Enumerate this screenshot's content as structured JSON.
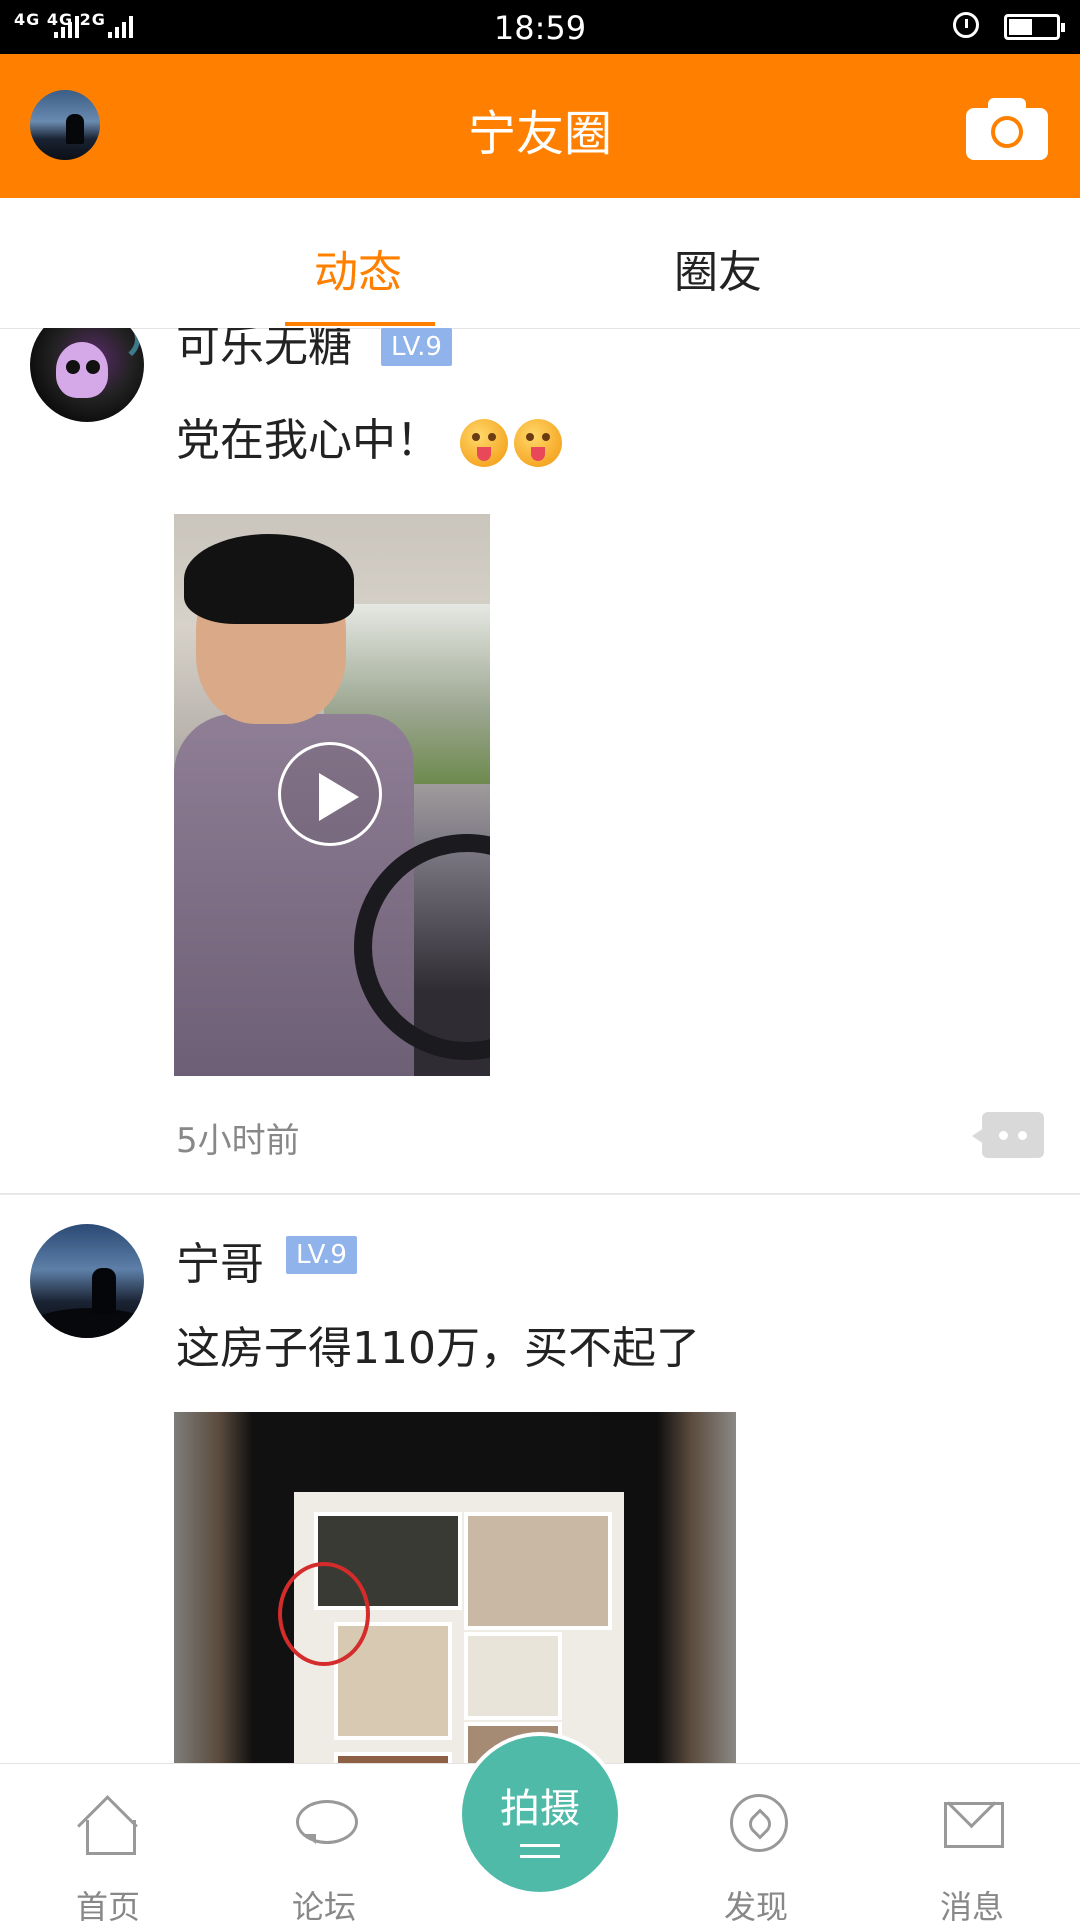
{
  "status_bar": {
    "network": "4G 4G 2G",
    "time": "18:59",
    "battery_level": 0.5
  },
  "header": {
    "title": "宁友圈"
  },
  "tabs": [
    {
      "label": "动态",
      "active": true
    },
    {
      "label": "圈友",
      "active": false
    }
  ],
  "posts": [
    {
      "username": "可乐无糖",
      "level": "LV.9",
      "text": "党在我心中！",
      "emoji": [
        "tongue-face-emoji",
        "tongue-face-emoji"
      ],
      "media": "video",
      "time": "5小时前"
    },
    {
      "username": "宁哥",
      "level": "LV.9",
      "text": "这房子得110万，买不起了",
      "media": "image"
    }
  ],
  "bottom_nav": {
    "items": [
      {
        "label": "首页",
        "icon": "home-icon"
      },
      {
        "label": "论坛",
        "icon": "chat-bubble-icon"
      },
      {
        "label": "发现",
        "icon": "compass-icon"
      },
      {
        "label": "消息",
        "icon": "mail-icon"
      }
    ],
    "center": {
      "label": "拍摄",
      "icon": "menu-lines-icon"
    }
  },
  "colors": {
    "accent": "#ff8000",
    "level_badge": "#8fb3ea",
    "center_button": "#4fbaa8"
  }
}
